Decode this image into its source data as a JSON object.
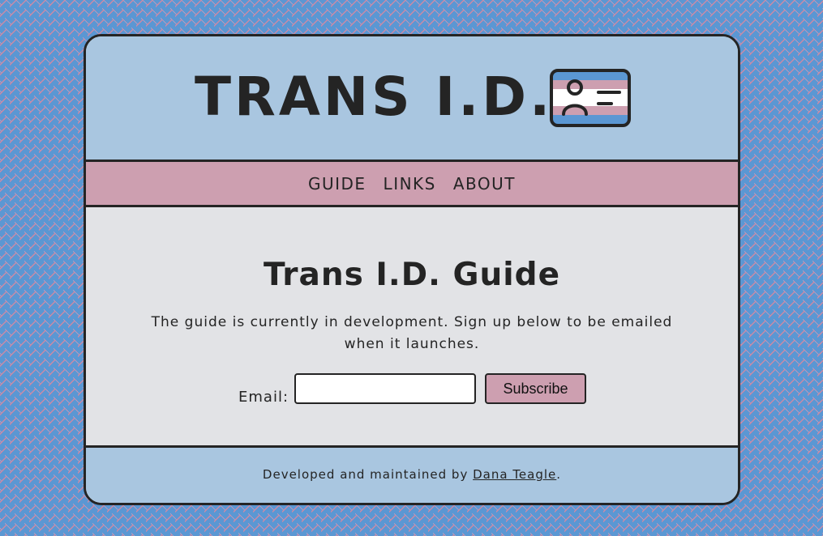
{
  "header": {
    "title": "TRANS I.D.",
    "logo_icon": "id-card-icon"
  },
  "nav": {
    "items": [
      {
        "label": "GUIDE"
      },
      {
        "label": "LINKS"
      },
      {
        "label": "ABOUT"
      }
    ]
  },
  "main": {
    "heading": "Trans I.D. Guide",
    "intro": "The guide is currently in development. Sign up below to be emailed when it launches.",
    "form": {
      "email_label": "Email:",
      "email_value": "",
      "email_placeholder": "",
      "submit_label": "Subscribe"
    }
  },
  "footer": {
    "prefix": "Developed and maintained by",
    "author_link": "Dana Teagle",
    "suffix": "."
  },
  "colors": {
    "page_background": "#5b97d3",
    "header_blue": "#a9c6e0",
    "nav_pink": "#cd9fb0",
    "content_gray": "#e2e3e6",
    "outline_dark": "#242424",
    "flag_white": "#ffffff"
  }
}
